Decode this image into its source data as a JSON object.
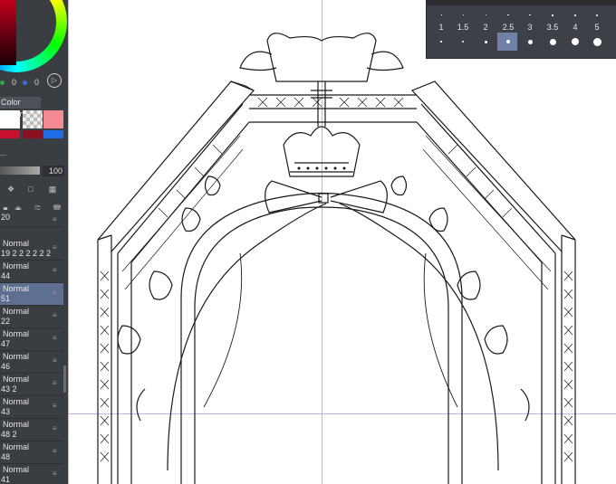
{
  "color_panel": {
    "rgb": {
      "r": "0",
      "g": "0",
      "b": "0"
    },
    "colors": {
      "wheel_indicator": "#ffffff",
      "current": "#b3001b"
    }
  },
  "color_history": {
    "title": "Color History",
    "swatches": [
      "#ffffff",
      "checker",
      "#f48a94",
      "#c8102e",
      "#8a0f1f",
      "#ff2a2a",
      "#1e6fe6"
    ]
  },
  "layer_panel": {
    "opacity": "100",
    "layers": [
      {
        "mode": "",
        "name": "20",
        "selected": false
      },
      {
        "mode": "Normal",
        "name": "19 2 2 2 2 2 2",
        "selected": false
      },
      {
        "mode": "Normal",
        "name": "44",
        "selected": false
      },
      {
        "mode": "Normal",
        "name": "51",
        "selected": true
      },
      {
        "mode": "Normal",
        "name": "22",
        "selected": false
      },
      {
        "mode": "Normal",
        "name": "47",
        "selected": false
      },
      {
        "mode": "Normal",
        "name": "46",
        "selected": false
      },
      {
        "mode": "Normal",
        "name": "43 2",
        "selected": false
      },
      {
        "mode": "Normal",
        "name": "43",
        "selected": false
      },
      {
        "mode": "Normal",
        "name": "48 2",
        "selected": false
      },
      {
        "mode": "Normal",
        "name": "48",
        "selected": false
      },
      {
        "mode": "Normal",
        "name": "41",
        "selected": false
      }
    ]
  },
  "brush_size": {
    "sizes": [
      "1",
      "1.5",
      "2",
      "2.5",
      "3",
      "3.5",
      "4",
      "5"
    ],
    "selected": "10",
    "colors": {
      "selected_bg": "#6f81a5"
    }
  },
  "canvas": {
    "colors": {
      "guide": "#b9b3ea",
      "ink": "#1a1a1a"
    }
  }
}
